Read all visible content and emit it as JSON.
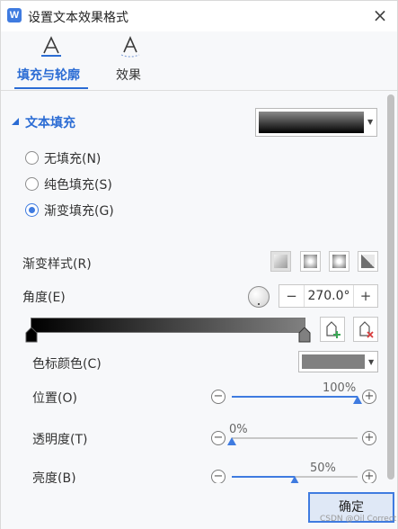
{
  "window": {
    "title": "设置文本效果格式",
    "app_icon_letter": "W",
    "close_glyph": "×"
  },
  "tabs": [
    {
      "label": "填充与轮廓",
      "icon": "text-fill-outline-icon",
      "active": true
    },
    {
      "label": "效果",
      "icon": "text-effects-icon",
      "active": false
    }
  ],
  "text_fill": {
    "title": "文本填充",
    "fill_options": [
      {
        "label": "无填充(N)",
        "checked": false
      },
      {
        "label": "纯色填充(S)",
        "checked": false
      },
      {
        "label": "渐变填充(G)",
        "checked": true
      }
    ],
    "gradient_style_label": "渐变样式(R)",
    "gradient_style_icons": [
      "linear-gradient-icon",
      "radial-gradient-icon",
      "rectangular-gradient-icon",
      "path-gradient-icon"
    ],
    "angle_label": "角度(E)",
    "angle_value": "270.0°",
    "minus_glyph": "−",
    "plus_glyph": "+",
    "stop_color_label": "色标颜色(C)",
    "stop_color": "#808080",
    "position": {
      "label": "位置(O)",
      "value_text": "100%",
      "value": 1.0
    },
    "transparency": {
      "label": "透明度(T)",
      "value_text": "0%",
      "value": 0.0
    },
    "brightness": {
      "label": "亮度(B)",
      "value_text": "50%",
      "value": 0.5
    }
  },
  "footer": {
    "ok_label": "确定",
    "watermark": "CSDN @Oil Correct"
  },
  "colors": {
    "accent": "#3f7be0",
    "tab_active": "#2b6cd4",
    "panel": "#f7f8fa"
  }
}
